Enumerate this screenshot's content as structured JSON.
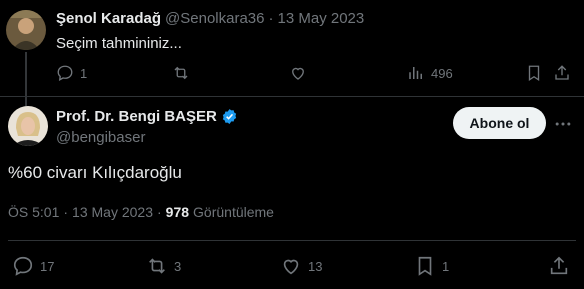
{
  "reply_tweet": {
    "name": "Şenol Karadağ",
    "handle": "@Senolkara36",
    "separator": "·",
    "date": "13 May 2023",
    "text": "Seçim tahmininiz...",
    "actions": {
      "replies": "1",
      "retweets": "",
      "likes": "",
      "views": "496"
    }
  },
  "main_tweet": {
    "name": "Prof. Dr. Bengi BAŞER",
    "handle": "@bengibaser",
    "follow_label": "Abone ol",
    "text": "%60 civarı Kılıçdaroğlu",
    "time": "ÖS 5:01",
    "separator": "·",
    "date": "13 May 2023",
    "separator2": "·",
    "views_count": "978",
    "views_label": "Görüntüleme",
    "actions": {
      "replies": "17",
      "retweets": "3",
      "likes": "13",
      "bookmarks": "1"
    }
  },
  "colors": {
    "background": "#000000",
    "text": "#e7e9ea",
    "muted": "#71767b",
    "verified": "#1d9bf0",
    "follow_bg": "#eff3f4"
  }
}
